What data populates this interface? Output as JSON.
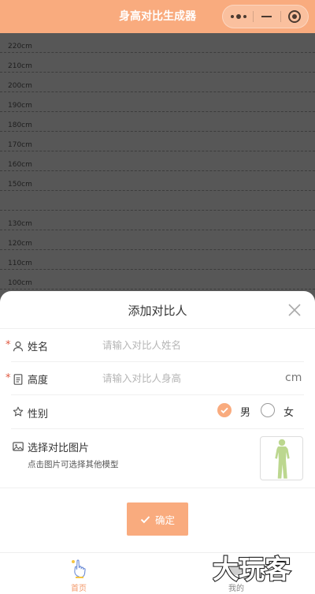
{
  "navbar": {
    "title": "身高对比生成器",
    "menu_icon": "more-dots-icon",
    "minimize_icon": "minimize-icon",
    "close_icon": "target-icon"
  },
  "ruler": {
    "labels": [
      "220cm",
      "210cm",
      "200cm",
      "190cm",
      "180cm",
      "170cm",
      "160cm",
      "150cm",
      "130cm",
      "120cm",
      "110cm",
      "100cm"
    ]
  },
  "sheet": {
    "title": "添加对比人",
    "fields": {
      "name": {
        "label": "姓名",
        "placeholder": "请输入对比人姓名",
        "value": "",
        "required_mark": "*"
      },
      "height": {
        "label": "高度",
        "placeholder": "请输入对比人身高",
        "value": "",
        "unit": "cm",
        "required_mark": "*"
      },
      "gender": {
        "label": "性别",
        "options": [
          "男",
          "女"
        ],
        "selected": "男"
      },
      "picture": {
        "label": "选择对比图片",
        "hint": "点击图片可选择其他模型"
      }
    },
    "confirm_label": "确定"
  },
  "tabbar": {
    "items": [
      {
        "label": "首页",
        "icon": "home-hand-icon",
        "active": true
      },
      {
        "label": "我的",
        "icon": "profile-icon",
        "active": false
      }
    ]
  },
  "watermark": {
    "text": "大玩客"
  },
  "colors": {
    "accent": "#f9ab7e",
    "background": "#575757",
    "required": "#e0573f",
    "model": "#bcd78f"
  }
}
